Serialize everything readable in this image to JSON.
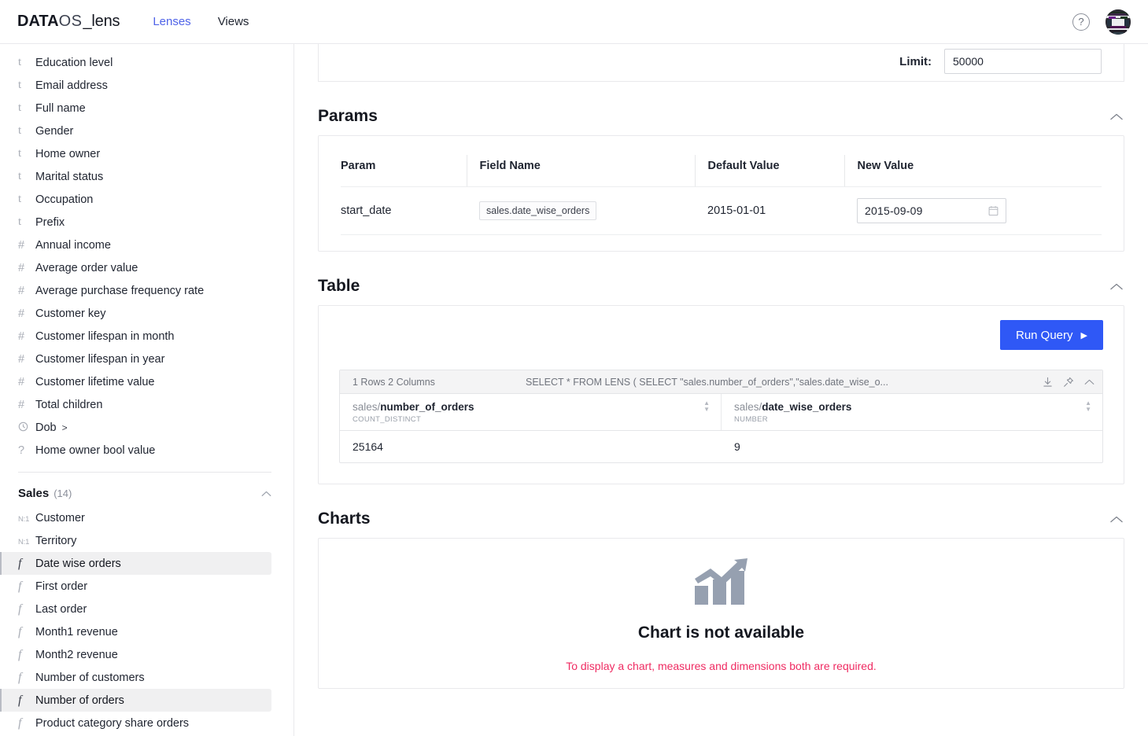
{
  "topbar": {
    "brand": {
      "data": "DATA",
      "os": "OS",
      "lens": "_lens"
    },
    "nav": [
      {
        "label": "Lenses",
        "active": true
      },
      {
        "label": "Views",
        "active": false
      }
    ],
    "help_icon": "question-mark-icon",
    "help_glyph": "?",
    "avatar": "user-avatar"
  },
  "sidebar": {
    "items": [
      {
        "type": "t",
        "label": "Education level"
      },
      {
        "type": "t",
        "label": "Email address"
      },
      {
        "type": "t",
        "label": "Full name"
      },
      {
        "type": "t",
        "label": "Gender"
      },
      {
        "type": "t",
        "label": "Home owner"
      },
      {
        "type": "t",
        "label": "Marital status"
      },
      {
        "type": "t",
        "label": "Occupation"
      },
      {
        "type": "t",
        "label": "Prefix"
      },
      {
        "type": "#",
        "label": "Annual income"
      },
      {
        "type": "#",
        "label": "Average order value"
      },
      {
        "type": "#",
        "label": "Average purchase frequency rate"
      },
      {
        "type": "#",
        "label": "Customer key"
      },
      {
        "type": "#",
        "label": "Customer lifespan in month"
      },
      {
        "type": "#",
        "label": "Customer lifespan in year"
      },
      {
        "type": "#",
        "label": "Customer lifetime value"
      },
      {
        "type": "#",
        "label": "Total children"
      },
      {
        "type": "clock",
        "label": "Dob",
        "expand": ">"
      },
      {
        "type": "?",
        "label": "Home owner bool value"
      }
    ],
    "group": {
      "name": "Sales",
      "count": "(14)",
      "chevron": "chevron-up-icon",
      "items": [
        {
          "type": "N:1",
          "label": "Customer",
          "selected": false
        },
        {
          "type": "N:1",
          "label": "Territory",
          "selected": false
        },
        {
          "type": "f",
          "label": "Date wise orders",
          "selected": true
        },
        {
          "type": "f",
          "label": "First order",
          "selected": false
        },
        {
          "type": "f",
          "label": "Last order",
          "selected": false
        },
        {
          "type": "f",
          "label": "Month1 revenue",
          "selected": false
        },
        {
          "type": "f",
          "label": "Month2 revenue",
          "selected": false
        },
        {
          "type": "f",
          "label": "Number of customers",
          "selected": false
        },
        {
          "type": "f",
          "label": "Number of orders",
          "selected": true
        },
        {
          "type": "f",
          "label": "Product category share orders",
          "selected": false
        }
      ]
    }
  },
  "main": {
    "limit": {
      "label": "Limit:",
      "value": "50000",
      "placeholder": "50000"
    },
    "params": {
      "title": "Params",
      "chevron": "chevron-up-icon",
      "columns": [
        "Param",
        "Field Name",
        "Default Value",
        "New Value"
      ],
      "rows": [
        {
          "param": "start_date",
          "field_name": "sales.date_wise_orders",
          "default_value": "2015-01-01",
          "new_value": "2015-09-09",
          "calendar_icon": "calendar-icon"
        }
      ]
    },
    "table": {
      "title": "Table",
      "chevron": "chevron-up-icon",
      "run_button": "Run Query",
      "run_icon": "play-icon",
      "grid": {
        "rows_summary": "1 Rows 2 Columns",
        "sql": "SELECT * FROM LENS ( SELECT \"sales.number_of_orders\",\"sales.date_wise_o...",
        "tools": [
          "download-icon",
          "pin-icon",
          "chevron-up-icon"
        ],
        "columns": [
          {
            "prefix": "sales/",
            "name": "number_of_orders",
            "type": "COUNT_DISTINCT"
          },
          {
            "prefix": "sales/",
            "name": "date_wise_orders",
            "type": "NUMBER"
          }
        ],
        "rows": [
          [
            "25164",
            "9"
          ]
        ]
      }
    },
    "charts": {
      "title": "Charts",
      "chevron": "chevron-up-icon",
      "icon": "bar-chart-trend-icon",
      "message": "Chart is not available",
      "submessage": "To display a chart, measures and dimensions both are required."
    }
  },
  "colors": {
    "accent_blue": "#2f58f6",
    "nav_active": "#4f63e8",
    "error_pink": "#ef2b62",
    "selected_bg": "#f0f0f1"
  }
}
